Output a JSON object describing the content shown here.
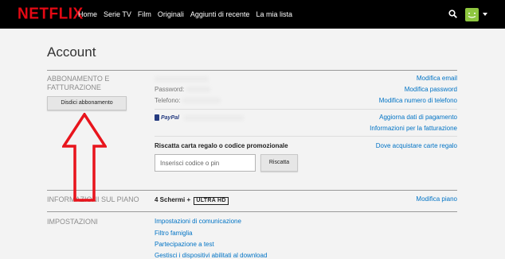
{
  "header": {
    "logo": "NETFLIX",
    "nav": [
      "Home",
      "Serie TV",
      "Film",
      "Originali",
      "Aggiunti di recente",
      "La mia lista"
    ]
  },
  "page": {
    "title": "Account"
  },
  "billing": {
    "label": "ABBONAMENTO E FATTURAZIONE",
    "cancel_button": "Disdici abbonamento",
    "password_label": "Password:",
    "phone_label": "Telefono:",
    "links": {
      "email": "Modifica email",
      "password": "Modifica password",
      "phone": "Modifica numero di telefono",
      "payment": "Aggiorna dati di pagamento",
      "invoice": "Informazioni per la fatturazione",
      "gift_where": "Dove acquistare carte regalo"
    },
    "paypal": "PayPal",
    "gift_title": "Riscatta carta regalo o codice promozionale",
    "code_placeholder": "Inserisci codice o pin",
    "redeem_button": "Riscatta"
  },
  "plan": {
    "label": "INFORMAZIONI SUL PIANO",
    "screens": "4 Schermi +",
    "badge": "ULTRA HD",
    "change_link": "Modifica piano"
  },
  "settings": {
    "label": "IMPOSTAZIONI",
    "links": [
      "Impostazioni di comunicazione",
      "Filtro famiglia",
      "Partecipazione a test",
      "Gestisci i dispositivi abilitati al download"
    ]
  },
  "colors": {
    "brand": "#e50914",
    "link": "#0073c5",
    "arrow": "#e8141c",
    "avatar": "#8ec63f"
  }
}
